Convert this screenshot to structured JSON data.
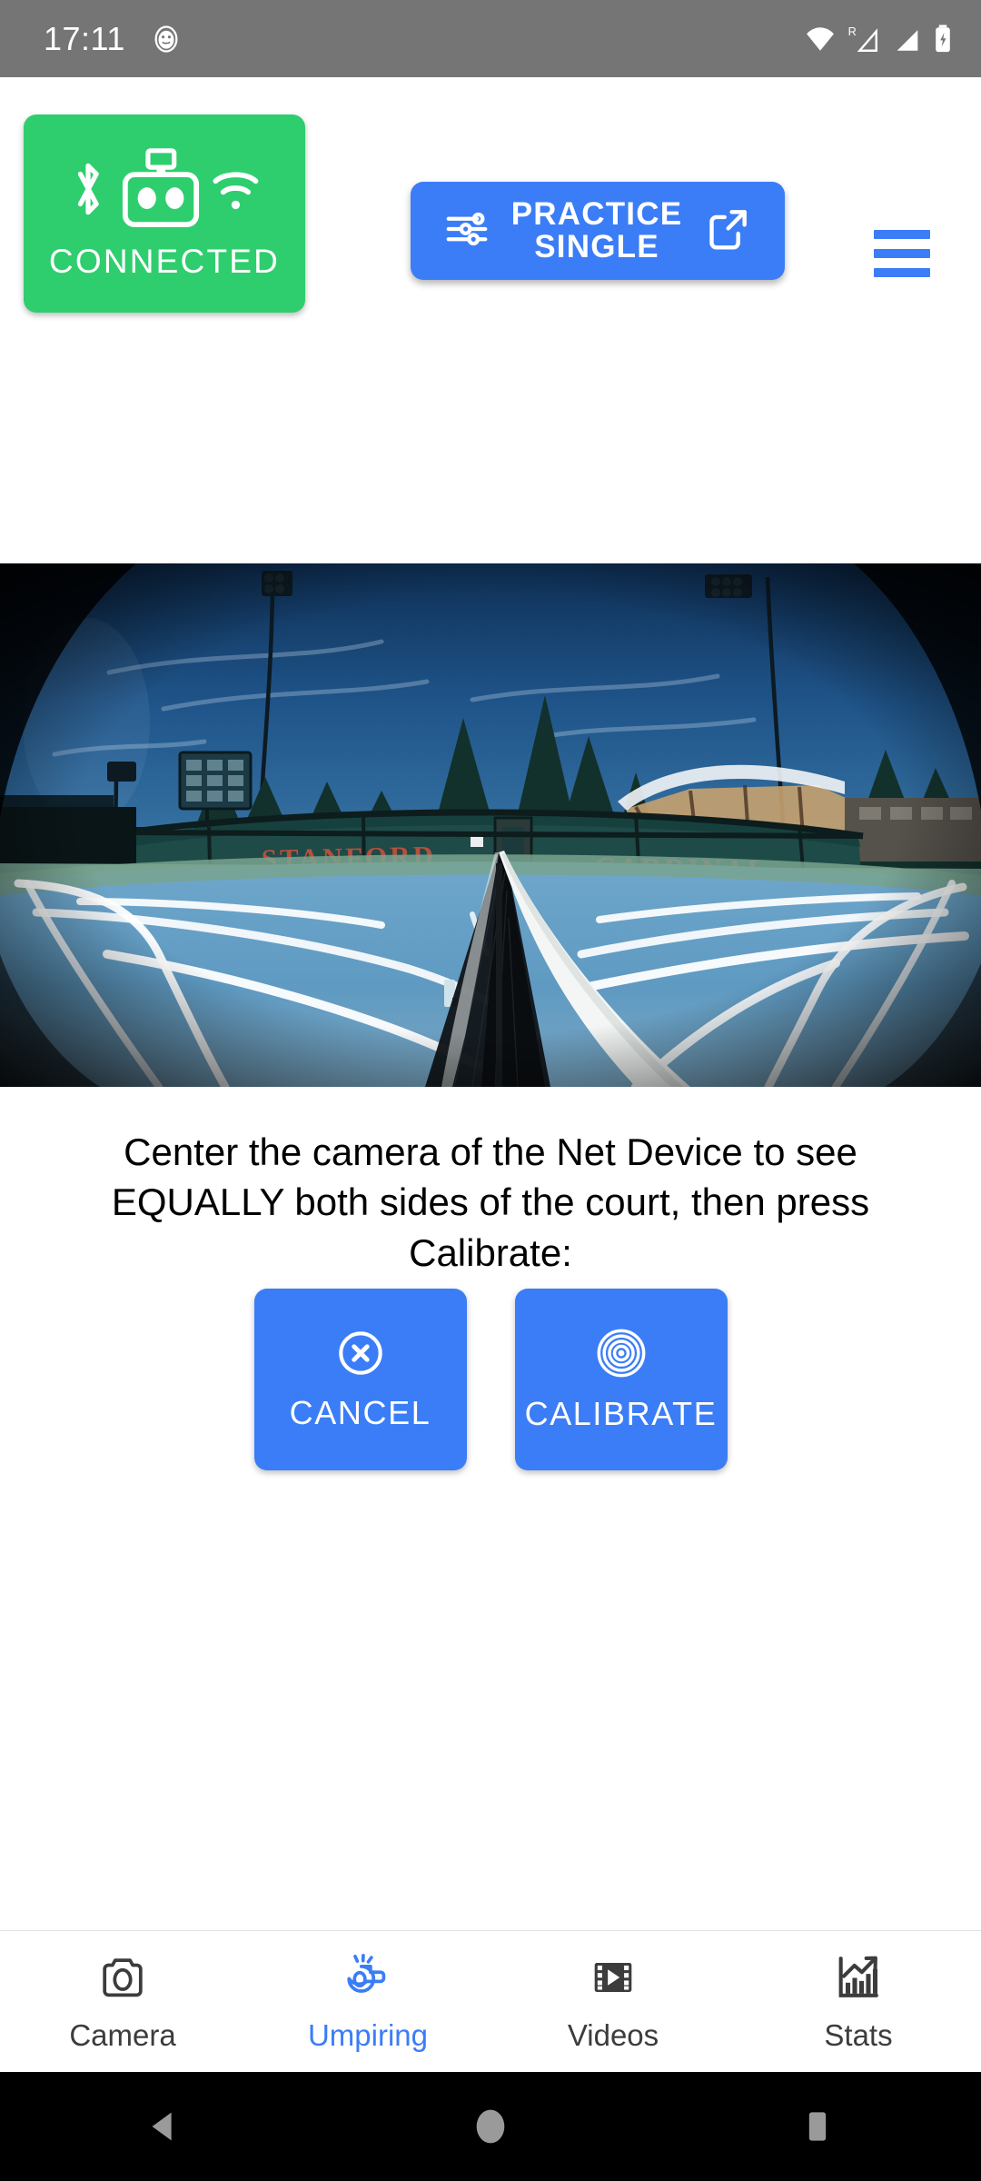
{
  "status_bar": {
    "clock": "17:11",
    "left_icons": [
      "notification-face-icon"
    ],
    "right_icons": [
      "wifi-icon",
      "roaming-signal-icon",
      "cellular-signal-icon",
      "battery-charging-icon"
    ],
    "background_color": "#757575",
    "foreground_color": "#ffffff"
  },
  "header": {
    "connection": {
      "label": "CONNECTED",
      "color": "#2ECE6E",
      "icons": [
        "bluetooth-icon",
        "net-device-icon",
        "wifi-icon"
      ]
    },
    "practice_button": {
      "label": "PRACTICE\nSINGLE",
      "color": "#3B7DF6",
      "left_icon": "tune-sliders-icon",
      "right_icon": "external-link-icon"
    },
    "menu_button": {
      "icon": "hamburger-menu-icon",
      "color": "#3B7DF6"
    }
  },
  "camera_preview": {
    "description": "Fisheye net-camera live view of a tennis court",
    "banner_text_left": "STANFORD",
    "banner_text_right": "CARDINAL",
    "court_surface_color": "#5E9AC4",
    "apron_color": "#7FA894",
    "sky_color": "#1d4f86",
    "banner_color": "#1e4a47",
    "banner_letter_color": "#b5503d"
  },
  "main": {
    "instruction": "Center the camera of the Net Device to see EQUALLY both sides of the court, then press Calibrate:",
    "buttons": [
      {
        "label": "CANCEL",
        "icon": "cancel-circle-x-icon",
        "color": "#3B7DF6"
      },
      {
        "label": "CALIBRATE",
        "icon": "target-concentric-circles-icon",
        "color": "#3B7DF6"
      }
    ]
  },
  "bottom_nav": {
    "active_color": "#3B7DF6",
    "inactive_color": "#3c3c3c",
    "items": [
      {
        "label": "Camera",
        "icon": "camera-icon",
        "active": false
      },
      {
        "label": "Umpiring",
        "icon": "whistle-icon",
        "active": true
      },
      {
        "label": "Videos",
        "icon": "film-play-icon",
        "active": false
      },
      {
        "label": "Stats",
        "icon": "bar-chart-trend-icon",
        "active": false
      }
    ]
  },
  "android_nav": {
    "items": [
      {
        "icon": "back-triangle-icon"
      },
      {
        "icon": "home-circle-icon"
      },
      {
        "icon": "recents-square-icon"
      }
    ],
    "background_color": "#000000",
    "icon_color": "#9a9a9a"
  }
}
